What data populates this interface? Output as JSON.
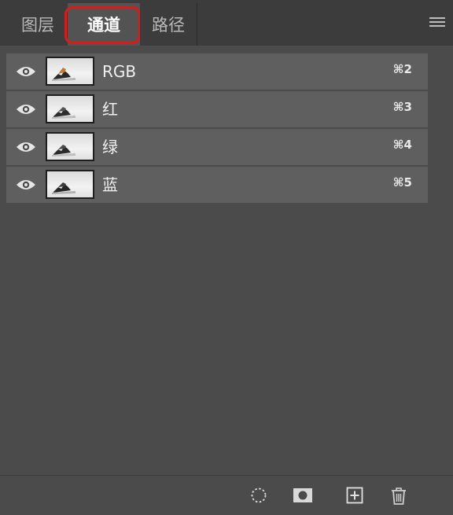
{
  "tabs": [
    {
      "label": "图层",
      "active": false
    },
    {
      "label": "通道",
      "active": true
    },
    {
      "label": "路径",
      "active": false
    }
  ],
  "highlight_color": "#e01818",
  "channels": [
    {
      "name": "RGB",
      "shortcut": "⌘2",
      "visible": true,
      "thumb": "color"
    },
    {
      "name": "红",
      "shortcut": "⌘3",
      "visible": true,
      "thumb": "gray"
    },
    {
      "name": "绿",
      "shortcut": "⌘4",
      "visible": true,
      "thumb": "gray"
    },
    {
      "name": "蓝",
      "shortcut": "⌘5",
      "visible": true,
      "thumb": "gray"
    }
  ],
  "footer_icons": [
    "load-selection-icon",
    "save-selection-mask-icon",
    "new-channel-icon",
    "delete-channel-icon"
  ]
}
